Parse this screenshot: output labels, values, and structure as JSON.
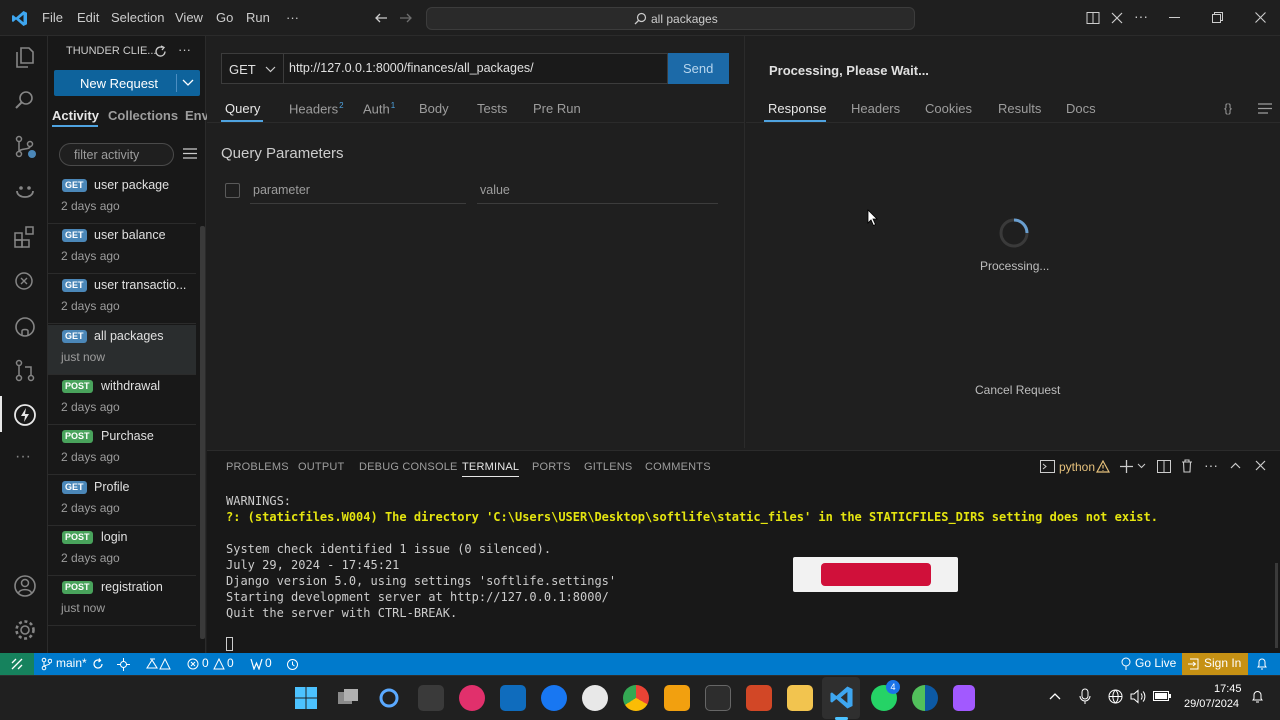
{
  "titlebar": {
    "menu": [
      "File",
      "Edit",
      "Selection",
      "View",
      "Go",
      "Run",
      "···"
    ],
    "command_center": "all packages"
  },
  "thunder": {
    "header": "THUNDER CLIE...",
    "new_request": "New Request",
    "tabs": [
      "Activity",
      "Collections",
      "Env"
    ],
    "filter_placeholder": "filter activity",
    "history": [
      {
        "method": "GET",
        "name": "user package",
        "time": "2 days ago"
      },
      {
        "method": "GET",
        "name": "user balance",
        "time": "2 days ago"
      },
      {
        "method": "GET",
        "name": "user transactio...",
        "time": "2 days ago"
      },
      {
        "method": "GET",
        "name": "all packages",
        "time": "just now"
      },
      {
        "method": "POST",
        "name": "withdrawal",
        "time": "2 days ago"
      },
      {
        "method": "POST",
        "name": "Purchase",
        "time": "2 days ago"
      },
      {
        "method": "GET",
        "name": "Profile",
        "time": "2 days ago"
      },
      {
        "method": "POST",
        "name": "login",
        "time": "2 days ago"
      },
      {
        "method": "POST",
        "name": "registration",
        "time": "just now"
      }
    ]
  },
  "request": {
    "method": "GET",
    "url": "http://127.0.0.1:8000/finances/all_packages/",
    "send": "Send",
    "tabs": {
      "query": "Query",
      "headers": "Headers",
      "headers_count": "2",
      "auth": "Auth",
      "auth_count": "1",
      "body": "Body",
      "tests": "Tests",
      "prerun": "Pre Run"
    },
    "query_title": "Query Parameters",
    "param_placeholder": "parameter",
    "value_placeholder": "value"
  },
  "response": {
    "status": "Processing, Please Wait...",
    "tabs": [
      "Response",
      "Headers",
      "Cookies",
      "Results",
      "Docs"
    ],
    "braces": "{}",
    "processing": "Processing...",
    "cancel": "Cancel Request"
  },
  "panel": {
    "tabs": [
      "PROBLEMS",
      "OUTPUT",
      "DEBUG CONSOLE",
      "TERMINAL",
      "PORTS",
      "GITLENS",
      "COMMENTS"
    ],
    "shell": "python",
    "lines": {
      "warnings": "WARNINGS:",
      "warn": "?: (staticfiles.W004) The directory 'C:\\Users\\USER\\Desktop\\softlife\\static_files' in the STATICFILES_DIRS setting does not exist.",
      "l1": "System check identified 1 issue (0 silenced).",
      "l2": "July 29, 2024 - 17:45:21",
      "l3": "Django version 5.0, using settings 'softlife.settings'",
      "l4": "Starting development server at http://127.0.0.1:8000/",
      "l5": "Quit the server with CTRL-BREAK."
    }
  },
  "statusbar": {
    "branch": "main*",
    "errors": "0",
    "warnings": "0",
    "ports": "0",
    "golive": "Go Live",
    "signin": "Sign In"
  },
  "taskbar": {
    "time": "17:45",
    "date": "29/07/2024",
    "whatsapp_badge": "4"
  },
  "colors": {
    "accent": "#007acc",
    "send": "#1c6aa8",
    "new_request": "#0e639c",
    "get_badge": "#4b87b8",
    "post_badge": "#49a35c",
    "warning_text": "#e5e510",
    "signin_bg": "#c69114"
  }
}
